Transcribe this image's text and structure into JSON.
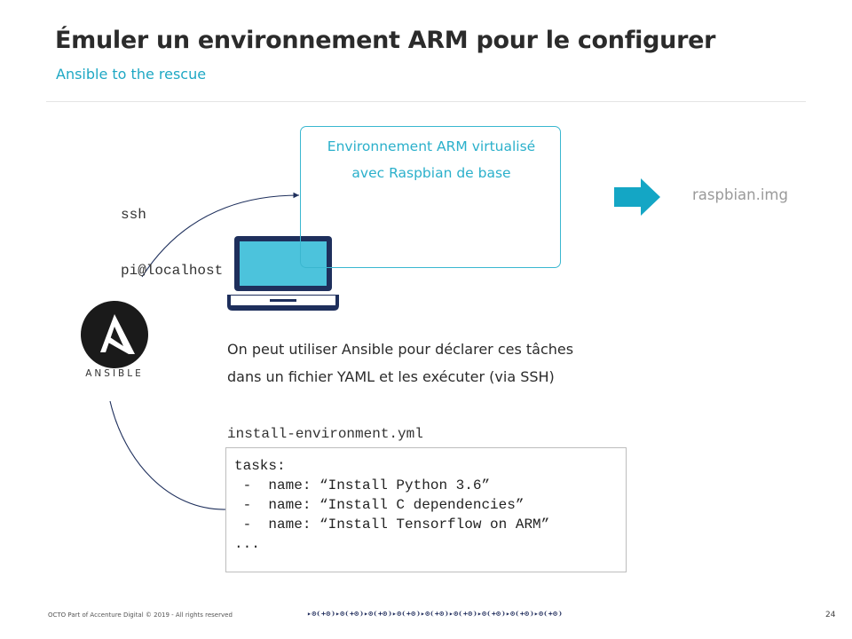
{
  "title": "Émuler un environnement ARM pour le configurer",
  "subtitle": "Ansible to the rescue",
  "ssh_command": [
    "ssh",
    "pi@localhost"
  ],
  "vm_label": [
    "Environnement ARM virtualisé",
    "avec Raspbian de base"
  ],
  "output_label": "raspbian.img",
  "ansible_logo": {
    "icon": "ansible-logo-icon",
    "text": "ANSIBLE"
  },
  "laptop_icon": "laptop-icon",
  "arrow_icon": "right-arrow-icon",
  "description": [
    "On peut utiliser Ansible pour déclarer ces tâches",
    "dans un fichier YAML et les exécuter (via SSH)"
  ],
  "yml_filename": "install-environment.yml",
  "code_lines": [
    "tasks:",
    " -  name: “Install Python 3.6”",
    " -  name: “Install C dependencies”",
    " -  name: “Install Tensorflow on ARM”",
    "..."
  ],
  "footer": {
    "text": "OCTO Part of Accenture Digital © 2019 - All rights reserved",
    "pattern": "▸⊙❨+⊙❩▸⊙❨+⊙❩▸⊙❨+⊙❩▸⊙❨+⊙❩▸⊙❨+⊙❩▸⊙❨+⊙❩▸⊙❨+⊙❩▸⊙❨+⊙❩▸⊙❨+⊙❩",
    "page_number": "24"
  },
  "colors": {
    "accent": "#1fa8c4",
    "vm_border": "#3ab7d0",
    "laptop_screen": "#4cc3dc",
    "laptop_frame": "#1e2f5c",
    "arrow": "#14a6c5",
    "ansible_logo": "#1a1a1a",
    "muted_text": "#9a9a9a"
  }
}
